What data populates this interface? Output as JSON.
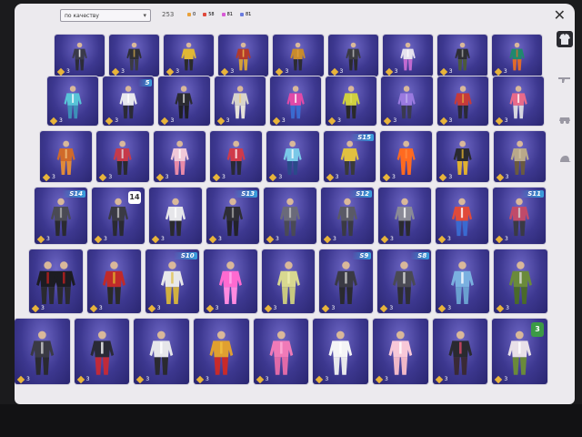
{
  "toolbar": {
    "sort_label": "по качеству",
    "total_count": "253",
    "counters": [
      {
        "color": "#e9a13a",
        "value": "0"
      },
      {
        "color": "#e0493c",
        "value": "58"
      },
      {
        "color": "#d85ad6",
        "value": "81"
      },
      {
        "color": "#6a7ce0",
        "value": "81"
      }
    ],
    "close_glyph": "✕"
  },
  "rows": [
    [
      {
        "qty": "3",
        "top": "#3a3a4a",
        "legs": "#2c2c38",
        "accent": "#ffffff"
      },
      {
        "qty": "3",
        "top": "#2f2f36",
        "legs": "#3b3b44",
        "accent": "#c9a34a"
      },
      {
        "qty": "3",
        "top": "#e0b835",
        "legs": "#2b2b2b",
        "accent": "#e0b835"
      },
      {
        "qty": "3",
        "top": "#b33a2a",
        "legs": "#d4a03a",
        "accent": "#f0c050"
      },
      {
        "qty": "3",
        "top": "#c88b2c",
        "legs": "#2c2c33",
        "accent": "#e0a040"
      },
      {
        "qty": "3",
        "top": "#3b3b42",
        "legs": "#2a2a30",
        "accent": "#c0c0c0"
      },
      {
        "qty": "3",
        "top": "#e6e2ee",
        "legs": "#c06ad0",
        "accent": "#ffffff"
      },
      {
        "qty": "3",
        "top": "#2e2e34",
        "legs": "#4c5a3a",
        "accent": "#aaaaaa"
      },
      {
        "qty": "3",
        "top": "#1f8a6c",
        "legs": "#e06a2a",
        "accent": "#e06a2a"
      }
    ],
    [
      {
        "qty": "3",
        "top": "#58c4d8",
        "legs": "#3d8fb8",
        "accent": "#ffffff"
      },
      {
        "qty": "3",
        "top": "#e8e8ee",
        "legs": "#2b2b36",
        "accent": "#ffffff",
        "badge": "5"
      },
      {
        "qty": "3",
        "top": "#2a2a30",
        "legs": "#1f1f25",
        "accent": "#d8d8d8"
      },
      {
        "qty": "3",
        "top": "#d8d4cc",
        "legs": "#e6e2da",
        "accent": "#f0d080"
      },
      {
        "qty": "3",
        "top": "#e04aa8",
        "legs": "#3a6ad0",
        "accent": "#ffffff"
      },
      {
        "qty": "3",
        "top": "#d0d040",
        "legs": "#2a2a2a",
        "accent": "#e0e060"
      },
      {
        "qty": "3",
        "top": "#9a7ae0",
        "legs": "#3a3a50",
        "accent": "#c0b0f0"
      },
      {
        "qty": "3",
        "top": "#c63a3a",
        "legs": "#2a2a36",
        "accent": "#e0a040"
      },
      {
        "qty": "3",
        "top": "#e86a8a",
        "legs": "#d6d6e0",
        "accent": "#ffffff"
      }
    ],
    [
      {
        "qty": "3",
        "top": "#d06a2a",
        "legs": "#e08a3a",
        "accent": "#f0c080"
      },
      {
        "qty": "3",
        "top": "#c63a4a",
        "legs": "#2a2a30",
        "accent": "#e0e0e0"
      },
      {
        "qty": "3",
        "top": "#f0c8d8",
        "legs": "#e88aa8",
        "accent": "#ffffff"
      },
      {
        "qty": "3",
        "top": "#d03a4a",
        "legs": "#2a2a36",
        "accent": "#ffffff"
      },
      {
        "qty": "3",
        "top": "#7ac8e8",
        "legs": "#2a4a8a",
        "accent": "#ffffff"
      },
      {
        "qty": "3",
        "top": "#e0c040",
        "legs": "#3a3a3a",
        "accent": "#e0c040",
        "badge": "S15"
      },
      {
        "qty": "3",
        "top": "#ff6a20",
        "legs": "#ff6a20",
        "accent": "#ff8a40"
      },
      {
        "qty": "3",
        "top": "#2a2a30",
        "legs": "#e0b030",
        "accent": "#e0b030"
      },
      {
        "qty": "3",
        "top": "#b8a88a",
        "legs": "#6a5a40",
        "accent": "#d0c0a0"
      }
    ],
    [
      {
        "qty": "3",
        "top": "#4a4a54",
        "legs": "#2a2a30",
        "accent": "#aaaaaa",
        "badge": "S14"
      },
      {
        "qty": "3",
        "top": "#3a3a44",
        "legs": "#2a2a32",
        "accent": "#c0c0c0",
        "badge2": "14"
      },
      {
        "qty": "3",
        "top": "#e6e6ea",
        "legs": "#2a2a2e",
        "accent": "#ffffff"
      },
      {
        "qty": "3",
        "top": "#2e2e36",
        "legs": "#22222a",
        "accent": "#a0a0a0",
        "badge": "S13"
      },
      {
        "qty": "3",
        "top": "#6a6a7a",
        "legs": "#4a4a56",
        "accent": "#c0c0c0"
      },
      {
        "qty": "3",
        "top": "#5a5a66",
        "legs": "#3a3a44",
        "accent": "#d0d0d0",
        "badge": "S12"
      },
      {
        "qty": "3",
        "top": "#8a8a96",
        "legs": "#2a2a30",
        "accent": "#ffffff"
      },
      {
        "qty": "3",
        "top": "#e04a3a",
        "legs": "#3a6ad0",
        "accent": "#ffffff"
      },
      {
        "qty": "3",
        "top": "#c04a6a",
        "legs": "#3a3a44",
        "accent": "#d0d0d0",
        "badge": "S11"
      }
    ],
    [
      {
        "qty": "3",
        "top": "#1c1c22",
        "legs": "#2a2a30",
        "accent": "#c02020",
        "pair": true
      },
      {
        "qty": "3",
        "top": "#c02a2a",
        "legs": "#2a2a2a",
        "accent": "#e0b030"
      },
      {
        "qty": "3",
        "top": "#e8e8ea",
        "legs": "#d0b040",
        "accent": "#e0c050",
        "badge": "S10"
      },
      {
        "qty": "3",
        "top": "#ff6ad0",
        "legs": "#ff8ae0",
        "accent": "#ffb0f0"
      },
      {
        "qty": "3",
        "top": "#d8d890",
        "legs": "#c8c880",
        "accent": "#f0f0b0"
      },
      {
        "qty": "3",
        "top": "#3a3a44",
        "legs": "#2a2a30",
        "accent": "#d0d0d0",
        "badge": "S9"
      },
      {
        "qty": "3",
        "top": "#4a4a54",
        "legs": "#2e2e36",
        "accent": "#e0e0e0",
        "badge": "S8"
      },
      {
        "qty": "3",
        "top": "#7ab0e0",
        "legs": "#6aa0d0",
        "accent": "#ffffff"
      },
      {
        "qty": "3",
        "top": "#6a8a3a",
        "legs": "#4a6a2a",
        "accent": "#e0e0e0"
      }
    ],
    [
      {
        "qty": "3",
        "top": "#3a3a44",
        "legs": "#2a2a30",
        "accent": "#d0d0d0"
      },
      {
        "qty": "3",
        "top": "#2a2a36",
        "legs": "#c02a3a",
        "accent": "#ffffff"
      },
      {
        "qty": "3",
        "top": "#e6e6ea",
        "legs": "#2a2a30",
        "accent": "#ffffff"
      },
      {
        "qty": "3",
        "top": "#e0a030",
        "legs": "#c82a2a",
        "accent": "#f0c040"
      },
      {
        "qty": "3",
        "top": "#f07ab8",
        "legs": "#e06aa8",
        "accent": "#ffb0d8"
      },
      {
        "qty": "3",
        "top": "#f4f4f6",
        "legs": "#e8e8ec",
        "accent": "#ffffff"
      },
      {
        "qty": "3",
        "top": "#f8c8d8",
        "legs": "#f0b8c8",
        "accent": "#ffffff"
      },
      {
        "qty": "3",
        "top": "#2a2a30",
        "legs": "#3a2a36",
        "accent": "#e04a6a"
      },
      {
        "qty": "3",
        "top": "#e8e0e8",
        "legs": "#6a8a3a",
        "accent": "#ffffff",
        "badgeG": "3"
      }
    ]
  ]
}
